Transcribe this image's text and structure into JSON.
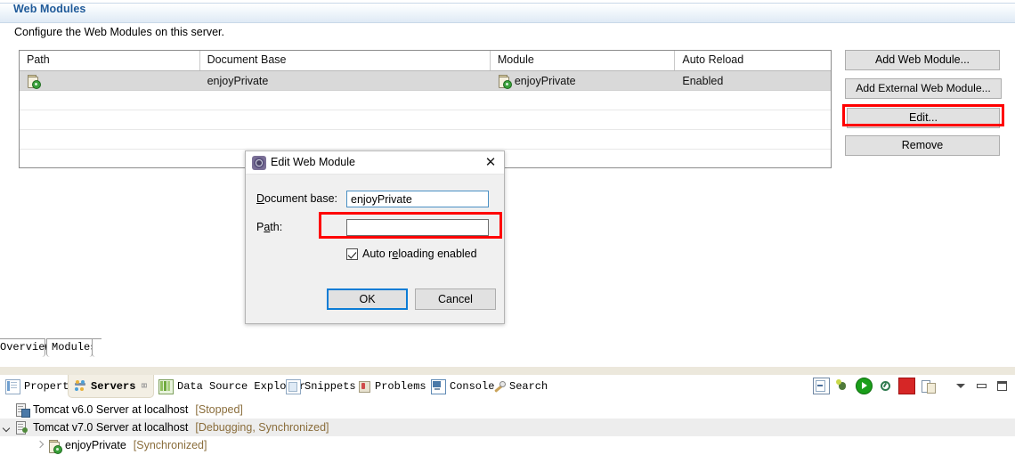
{
  "form": {
    "title": "Web Modules",
    "description": "Configure the Web Modules on this server."
  },
  "table": {
    "columns": [
      "Path",
      "Document Base",
      "Module",
      "Auto Reload"
    ],
    "rows": [
      {
        "path": "",
        "path_icon": "web-module-icon",
        "document_base": "enjoyPrivate",
        "module": "enjoyPrivate",
        "module_icon": "web-module-icon",
        "auto_reload": "Enabled",
        "selected": true
      }
    ],
    "empty_row_count": 4
  },
  "side_buttons": [
    {
      "label": "Add Web Module...",
      "name": "add-web-module-button",
      "highlighted": false
    },
    {
      "label": "Add External Web Module...",
      "name": "add-external-web-module-button",
      "highlighted": false
    },
    {
      "label": "Edit...",
      "name": "edit-button",
      "highlighted": true
    },
    {
      "label": "Remove",
      "name": "remove-button",
      "highlighted": false
    }
  ],
  "highlight_color": "#ff0000",
  "dialog": {
    "title": "Edit Web Module",
    "icon": "module-gear-icon",
    "close_label": "✕",
    "document_base_label_pre": "D",
    "document_base_label_post": "ocument base:",
    "document_base_value": "enjoyPrivate",
    "path_label_pre": "P",
    "path_label_mid": "a",
    "path_label_post": "th:",
    "path_value": "",
    "path_placeholder": "",
    "auto_reload_pre": "Auto r",
    "auto_reload_mid": "e",
    "auto_reload_post": "loading enabled",
    "auto_reload_checked": true,
    "ok_label": "OK",
    "cancel_label": "Cancel"
  },
  "page_tabs": [
    {
      "label": "Overview",
      "active": false
    },
    {
      "label": "Modules",
      "active": true
    }
  ],
  "view_tabs": [
    {
      "label": "Properties",
      "icon": "properties-icon",
      "active": false,
      "closable": false
    },
    {
      "label": "Servers",
      "icon": "servers-icon",
      "active": true,
      "closable": true,
      "close_glyph": "⌧"
    },
    {
      "label": "Data Source Explorer",
      "icon": "data-source-explorer-icon",
      "active": false,
      "closable": false
    },
    {
      "label": "Snippets",
      "icon": "snippets-icon",
      "active": false,
      "closable": false
    },
    {
      "label": "Problems",
      "icon": "problems-icon",
      "active": false,
      "closable": false
    },
    {
      "label": "Console",
      "icon": "console-icon",
      "active": false,
      "closable": false
    },
    {
      "label": "Search",
      "icon": "search-icon",
      "active": false,
      "closable": false
    }
  ],
  "view_toolbar": [
    {
      "name": "collapse-all-icon"
    },
    {
      "name": "debug-icon"
    },
    {
      "name": "run-icon"
    },
    {
      "name": "profile-icon"
    },
    {
      "name": "stop-icon"
    },
    {
      "name": "publish-icon"
    },
    {
      "name": "view-menu-icon"
    },
    {
      "name": "minimize-icon"
    },
    {
      "name": "maximize-icon"
    }
  ],
  "servers_tree": [
    {
      "label": "Tomcat v6.0 Server at localhost",
      "status": "[Stopped]",
      "icon": "server-stopped-icon",
      "expander": "none",
      "indent": 1,
      "selected": false
    },
    {
      "label": "Tomcat v7.0 Server at localhost",
      "status": "[Debugging, Synchronized]",
      "icon": "server-debugging-icon",
      "expander": "down",
      "indent": 0,
      "selected": true
    },
    {
      "label": "enjoyPrivate",
      "status": "[Synchronized]",
      "icon": "web-module-icon",
      "expander": "right",
      "indent": 2,
      "selected": false
    }
  ]
}
